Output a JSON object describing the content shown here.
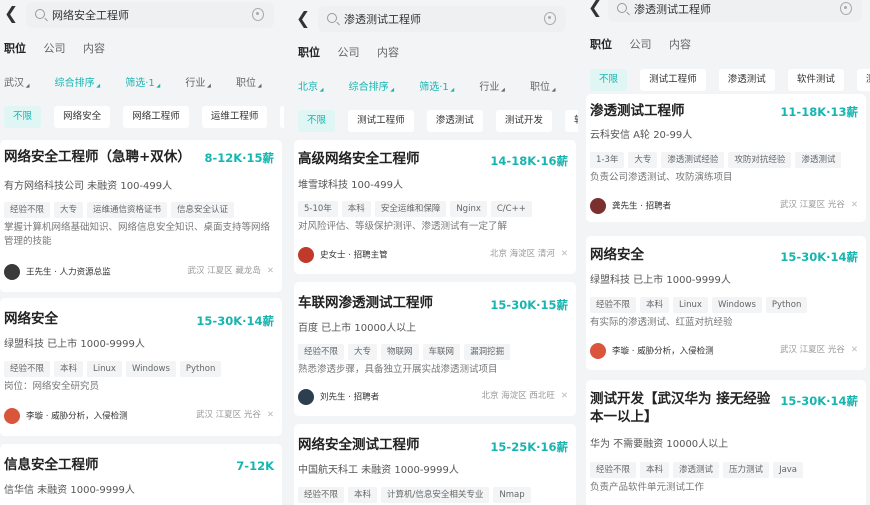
{
  "panels": [
    {
      "query": "网络安全工程师",
      "tabs": [
        "职位",
        "公司",
        "内容"
      ],
      "filters": [
        {
          "label": "武汉",
          "on": false
        },
        {
          "label": "综合排序",
          "on": true
        },
        {
          "label": "筛选·1",
          "on": true
        },
        {
          "label": "行业",
          "on": false
        },
        {
          "label": "职位",
          "on": false
        }
      ],
      "chips": [
        "不限",
        "网络安全",
        "网络工程师",
        "运维工程师",
        "光讯"
      ],
      "cards": [
        {
          "title": "网络安全工程师（急聘+双休）",
          "salary": "8-12K·15薪",
          "company": "有方网络科技公司 未融资 100-499人",
          "tags": [
            "经验不限",
            "大专",
            "运维通信资格证书",
            "信息安全认证"
          ],
          "desc": "掌握计算机网络基础知识、网络信息安全知识、桌面支持等网络管理的技能",
          "recruiter": "王先生 · 人力资源总监",
          "location": "武汉 江夏区 藏龙岛"
        },
        {
          "title": "网络安全",
          "salary": "15-30K·14薪",
          "company": "绿盟科技 已上市 1000-9999人",
          "tags": [
            "经验不限",
            "本科",
            "Linux",
            "Windows",
            "Python"
          ],
          "desc": "岗位：网络安全研究员",
          "recruiter": "李璇 · 威胁分析，入侵检测",
          "location": "武汉 江夏区 光谷"
        },
        {
          "title": "信息安全工程师",
          "salary": "7-12K",
          "company": "信华信 未融资 1000-9999人",
          "tags": [],
          "desc": "",
          "recruiter": "",
          "location": ""
        }
      ]
    },
    {
      "query": "渗透测试工程师",
      "tabs": [
        "职位",
        "公司",
        "内容"
      ],
      "filters": [
        {
          "label": "北京",
          "on": true
        },
        {
          "label": "综合排序",
          "on": true
        },
        {
          "label": "筛选·1",
          "on": true
        },
        {
          "label": "行业",
          "on": false
        },
        {
          "label": "职位",
          "on": false
        }
      ],
      "chips": [
        "不限",
        "测试工程师",
        "渗透测试",
        "测试开发",
        "软件测"
      ],
      "cards": [
        {
          "title": "高级网络安全工程师",
          "salary": "14-18K·16薪",
          "company": "堆雪球科技 100-499人",
          "tags": [
            "5-10年",
            "本科",
            "安全运维和保障",
            "Nginx",
            "C/C++"
          ],
          "desc": "对风险评估、等级保护测评、渗透测试有一定了解",
          "recruiter": "史女士 · 招聘主管",
          "location": "北京 海淀区 清河"
        },
        {
          "title": "车联网渗透测试工程师",
          "salary": "15-30K·15薪",
          "company": "百度 已上市 10000人以上",
          "tags": [
            "经验不限",
            "大专",
            "物联网",
            "车联网",
            "漏洞挖掘"
          ],
          "desc": "熟悉渗透步骤，具备独立开展实战渗透测试项目",
          "recruiter": "刘先生 · 招聘者",
          "location": "北京 海淀区 西北旺"
        },
        {
          "title": "网络安全测试工程师",
          "salary": "15-25K·16薪",
          "company": "中国航天科工 未融资 1000-9999人",
          "tags": [
            "经验不限",
            "本科",
            "计算机/信息安全相关专业",
            "Nmap"
          ],
          "desc": "",
          "recruiter": "",
          "location": ""
        }
      ]
    },
    {
      "query": "渗透测试工程师",
      "tabs": [
        "职位",
        "公司",
        "内容"
      ],
      "chips": [
        "不限",
        "测试工程师",
        "渗透测试",
        "软件测试",
        "测试"
      ],
      "cards": [
        {
          "title": "渗透测试工程师",
          "salary": "11-18K·13薪",
          "company": "云科安信 A轮 20-99人",
          "tags": [
            "1-3年",
            "大专",
            "渗透测试经验",
            "攻防对抗经验",
            "渗透测试"
          ],
          "desc": "负责公司渗透测试、攻防演练项目",
          "recruiter": "龚先生 · 招聘者",
          "location": "武汉 江夏区 光谷"
        },
        {
          "title": "网络安全",
          "salary": "15-30K·14薪",
          "company": "绿盟科技 已上市 1000-9999人",
          "tags": [
            "经验不限",
            "本科",
            "Linux",
            "Windows",
            "Python"
          ],
          "desc": "有实际的渗透测试、红蓝对抗经验",
          "recruiter": "李璇 · 威胁分析，入侵检测",
          "location": "武汉 江夏区 光谷"
        },
        {
          "title": "测试开发【武汉华为 接无经验本一以上】",
          "salary": "15-30K·14薪",
          "company": "华为 不需要融资 10000人以上",
          "tags": [
            "经验不限",
            "本科",
            "渗透测试",
            "压力测试",
            "Java"
          ],
          "desc": "负责产品软件单元测试工作",
          "recruiter": "",
          "location": ""
        }
      ]
    }
  ],
  "colors": {
    "accent": "#16b5b0",
    "background": "#f3f4f6",
    "card": "#ffffff"
  }
}
